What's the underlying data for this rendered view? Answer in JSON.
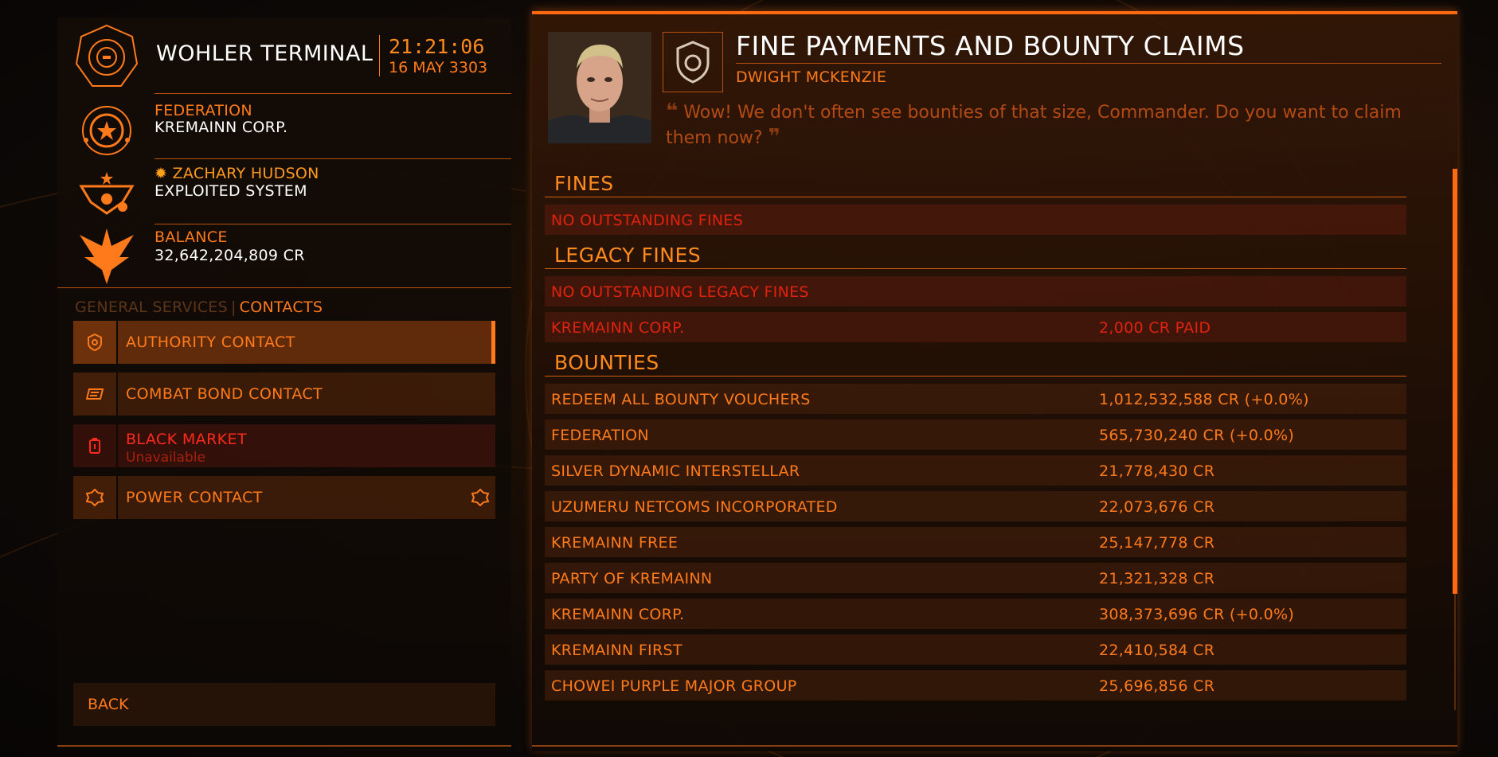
{
  "station": {
    "name": "WOHLER TERMINAL",
    "time": "21:21:06",
    "date": "16 MAY 3303"
  },
  "faction": {
    "allegiance": "FEDERATION",
    "controlling": "KREMAINN CORP."
  },
  "power": {
    "name": "ZACHARY HUDSON",
    "state": "EXPLOITED SYSTEM"
  },
  "balance": {
    "label": "BALANCE",
    "value": "32,642,204,809 CR"
  },
  "tabs": {
    "general": "GENERAL SERVICES",
    "separator": "|",
    "contacts": "CONTACTS"
  },
  "menu": {
    "items": [
      {
        "label": "AUTHORITY CONTACT",
        "icon": "authority-icon"
      },
      {
        "label": "COMBAT BOND CONTACT",
        "icon": "combat-bond-icon"
      },
      {
        "label": "BLACK MARKET",
        "sub": "Unavailable",
        "icon": "black-market-icon"
      },
      {
        "label": "POWER CONTACT",
        "icon": "power-icon"
      }
    ],
    "back": "BACK"
  },
  "screen": {
    "title": "FINE PAYMENTS AND BOUNTY CLAIMS",
    "contact": "DWIGHT MCKENZIE",
    "quote": "Wow! We don't often see bounties of that size, Commander. Do you want to claim them now?",
    "quote_open": "❝",
    "quote_close": "❞"
  },
  "fines": {
    "heading": "FINES",
    "rows": [
      {
        "name": "NO OUTSTANDING FINES",
        "value": ""
      }
    ]
  },
  "legacy_fines": {
    "heading": "LEGACY FINES",
    "rows": [
      {
        "name": "NO OUTSTANDING LEGACY FINES",
        "value": ""
      },
      {
        "name": "KREMAINN CORP.",
        "value": "2,000 CR PAID"
      }
    ]
  },
  "bounties": {
    "heading": "BOUNTIES",
    "rows": [
      {
        "name": "REDEEM ALL BOUNTY VOUCHERS",
        "value": "1,012,532,588 CR (+0.0%)"
      },
      {
        "name": "FEDERATION",
        "value": "565,730,240 CR (+0.0%)"
      },
      {
        "name": "SILVER DYNAMIC INTERSTELLAR",
        "value": "21,778,430 CR"
      },
      {
        "name": "UZUMERU NETCOMS INCORPORATED",
        "value": "22,073,676 CR"
      },
      {
        "name": "KREMAINN FREE",
        "value": "25,147,778 CR"
      },
      {
        "name": "PARTY OF KREMAINN",
        "value": "21,321,328 CR"
      },
      {
        "name": "KREMAINN CORP.",
        "value": "308,373,696 CR (+0.0%)"
      },
      {
        "name": "KREMAINN FIRST",
        "value": "22,410,584 CR"
      },
      {
        "name": "CHOWEI PURPLE MAJOR GROUP",
        "value": "25,696,856 CR"
      }
    ]
  },
  "colors": {
    "accent": "#ff7a1a",
    "warning": "#e0220f",
    "text_white": "#ffffff"
  }
}
